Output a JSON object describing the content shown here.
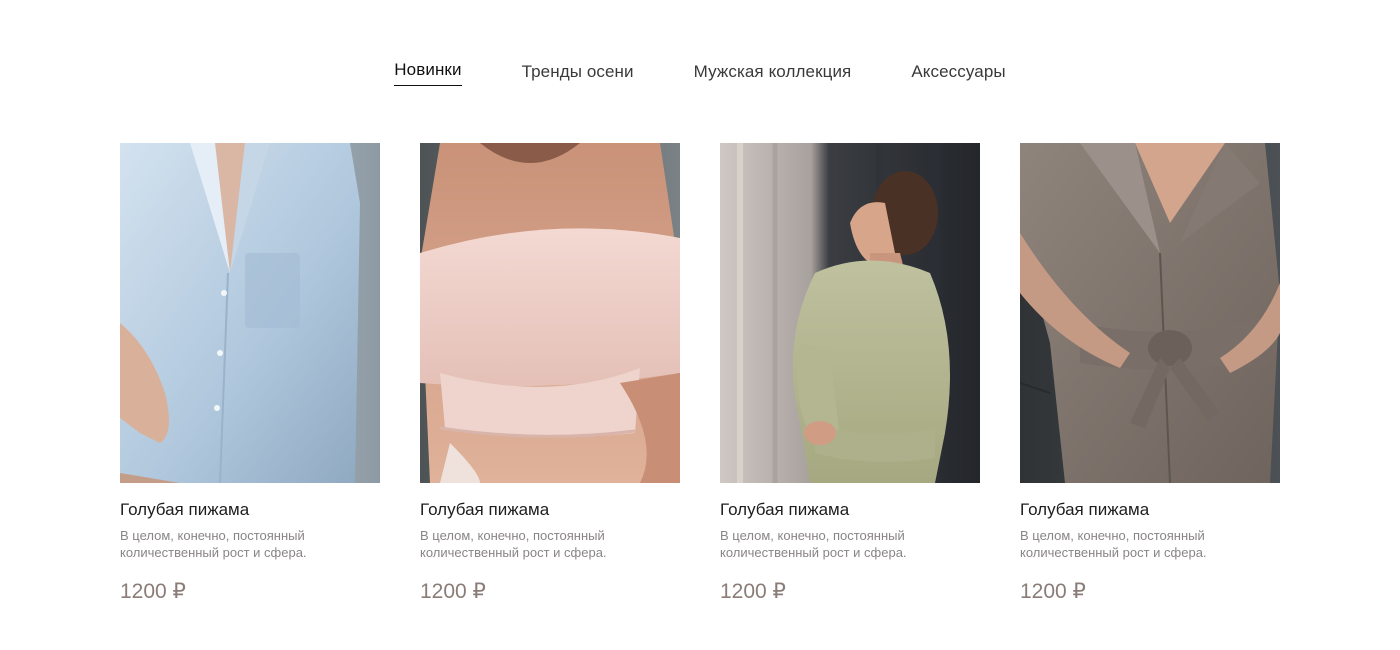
{
  "nav": {
    "tabs": [
      {
        "label": "Новинки",
        "active": true
      },
      {
        "label": "Тренды осени",
        "active": false
      },
      {
        "label": "Мужская коллекция",
        "active": false
      },
      {
        "label": "Аксессуары",
        "active": false
      }
    ]
  },
  "products": [
    {
      "title": "Голубая пижама",
      "description": "В целом, конечно, постоянный количественный рост и сфера.",
      "price": "1200 ₽",
      "image_color": "#b7cde0"
    },
    {
      "title": "Голубая пижама",
      "description": "В целом, конечно, постоянный количественный рост и сфера.",
      "price": "1200 ₽",
      "image_color": "#efd2cc"
    },
    {
      "title": "Голубая пижама",
      "description": "В целом, конечно, постоянный количественный рост и сфера.",
      "price": "1200 ₽",
      "image_color": "#b9bb98"
    },
    {
      "title": "Голубая пижама",
      "description": "В целом, конечно, постоянный количественный рост и сфера.",
      "price": "1200 ₽",
      "image_color": "#7d726b"
    }
  ],
  "colors": {
    "price": "#8a7d78",
    "description": "#8a8585",
    "text": "#1d1d1d"
  }
}
